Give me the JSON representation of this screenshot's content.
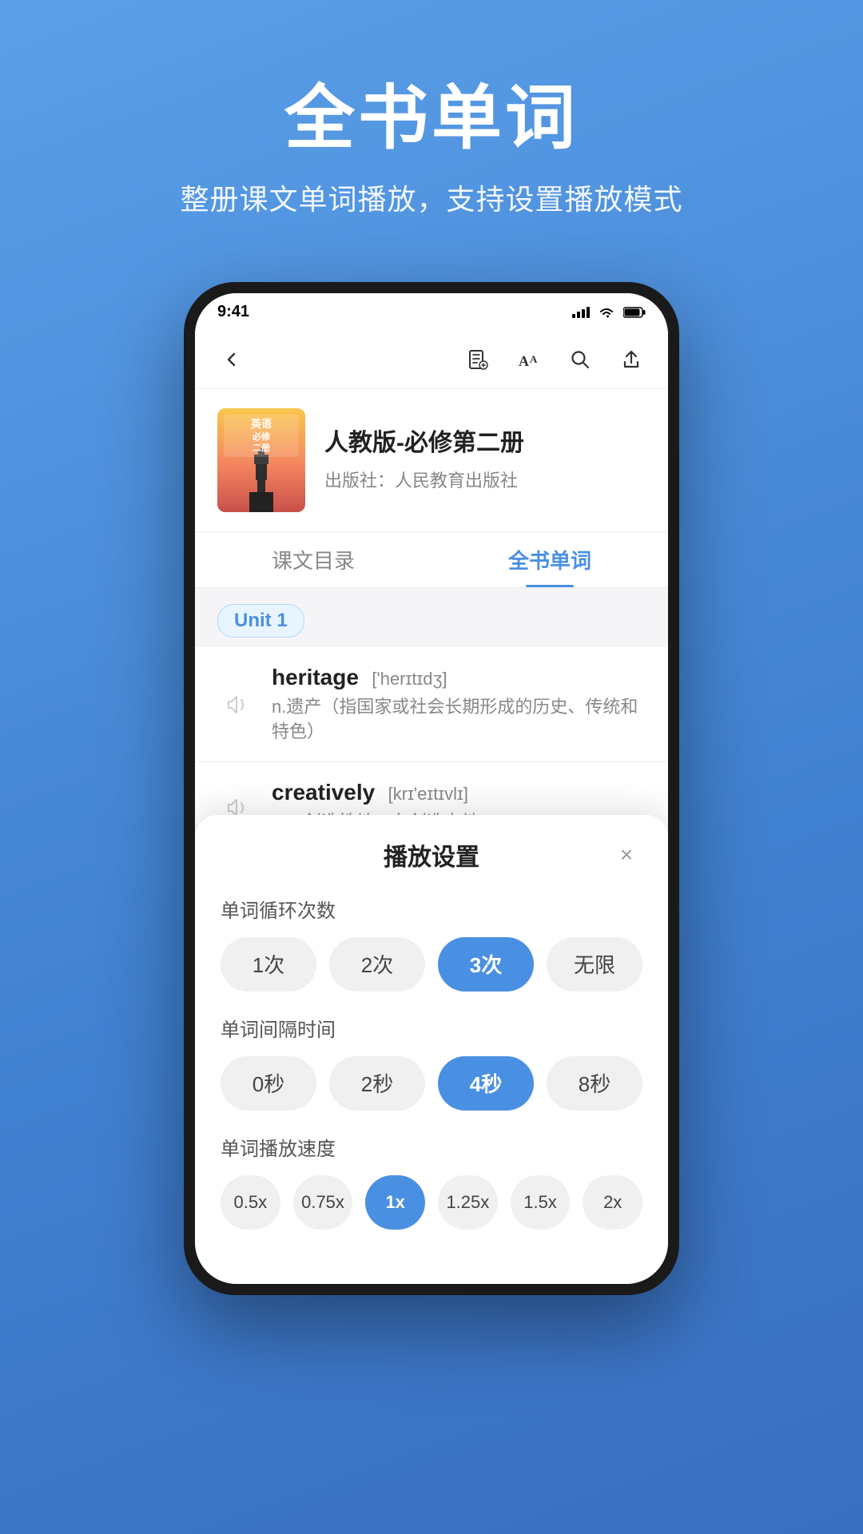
{
  "page": {
    "background_color": "#4a90e2"
  },
  "header": {
    "title": "全书单词",
    "subtitle": "整册课文单词播放，支持设置播放模式"
  },
  "phone": {
    "status_bar": {
      "time": "9:41",
      "signal": true,
      "wifi": true,
      "battery": true
    },
    "nav": {
      "back_icon": "←",
      "actions": [
        "clip-icon",
        "font-icon",
        "search-icon",
        "share-icon"
      ]
    },
    "book_info": {
      "title": "人教版-必修第二册",
      "publisher": "出版社：人民教育出版社",
      "cover_label": "英语"
    },
    "tabs": [
      {
        "id": "catalog",
        "label": "课文目录",
        "active": false
      },
      {
        "id": "words",
        "label": "全书单词",
        "active": true
      }
    ],
    "unit_badge": "Unit 1",
    "words": [
      {
        "en": "heritage",
        "phonetic": "['herɪtɪdʒ]",
        "cn": "n.遗产（指国家或社会长期形成的历史、传统和特色）"
      },
      {
        "en": "creatively",
        "phonetic": "[krɪ'eɪtɪvlɪ]",
        "cn": "adv.创造性地；有创造力地"
      }
    ],
    "settings_panel": {
      "title": "播放设置",
      "close_label": "×",
      "sections": [
        {
          "label": "单词循环次数",
          "options": [
            "1次",
            "2次",
            "3次",
            "无限"
          ],
          "active_index": 2
        },
        {
          "label": "单词间隔时间",
          "options": [
            "0秒",
            "2秒",
            "4秒",
            "8秒"
          ],
          "active_index": 2
        },
        {
          "label": "单词播放速度",
          "options": [
            "0.5x",
            "0.75x",
            "1x",
            "1.25x",
            "1.5x",
            "2x"
          ],
          "active_index": 2
        }
      ]
    }
  }
}
